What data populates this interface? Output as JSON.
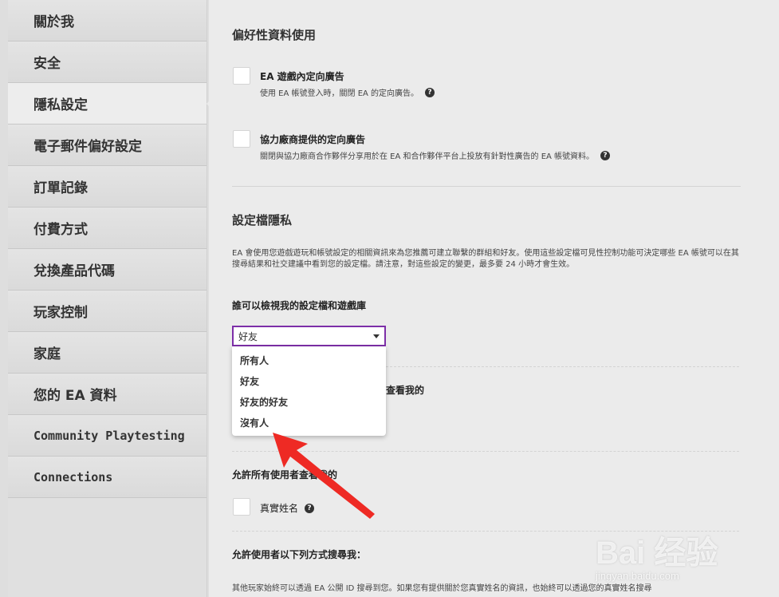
{
  "sidebar": {
    "items": [
      {
        "label": "關於我"
      },
      {
        "label": "安全"
      },
      {
        "label": "隱私設定"
      },
      {
        "label": "電子郵件偏好設定"
      },
      {
        "label": "訂單記錄"
      },
      {
        "label": "付費方式"
      },
      {
        "label": "兌換產品代碼"
      },
      {
        "label": "玩家控制"
      },
      {
        "label": "家庭"
      },
      {
        "label": "您的 EA 資料"
      },
      {
        "label": "Community Playtesting"
      },
      {
        "label": "Connections"
      }
    ],
    "active_index": 2
  },
  "preferences": {
    "title": "偏好性資料使用",
    "ingame_ads": {
      "label": "EA 遊戲內定向廣告",
      "desc": "使用 EA 帳號登入時，關閉 EA 的定向廣告。",
      "checked": false
    },
    "partner_ads": {
      "label": "協力廠商提供的定向廣告",
      "desc": "關閉與協力廠商合作夥伴分享用於在 EA 和合作夥伴平台上投放有針對性廣告的 EA 帳號資料。",
      "checked": false
    }
  },
  "profile_privacy": {
    "title": "設定檔隱私",
    "description": "EA 會使用您遊戲遊玩和帳號設定的相關資訊來為您推薦可建立聯繫的群組和好友。使用這些設定檔可見性控制功能可決定哪些 EA 帳號可以在其搜尋結果和社交建議中看到您的設定檔。請注意，對這些設定的變更，最多要 24 小時才會生效。",
    "who_can_view_label": "誰可以檢視我的設定檔和遊戲庫",
    "selected_value": "好友",
    "options": [
      "所有人",
      "好友",
      "好友的好友",
      "沒有人"
    ],
    "hidden_label_fragment": "看查看我的",
    "allow_all_label": "允許所有使用者查看我的",
    "real_name": {
      "label": "真實姓名",
      "checked": false
    },
    "search_label": "允許使用者以下列方式搜尋我：",
    "search_desc": "其他玩家始終可以透過 EA 公開 ID 搜尋到您。如果您有提供關於您真實姓名的資訊，也始終可以透過您的真實姓名搜尋"
  },
  "watermark": {
    "brand": "Bai 经验",
    "url": "jingyan.baidu.com"
  },
  "colors": {
    "accent_border": "#7d2fa8",
    "arrow": "#ee2a24"
  }
}
